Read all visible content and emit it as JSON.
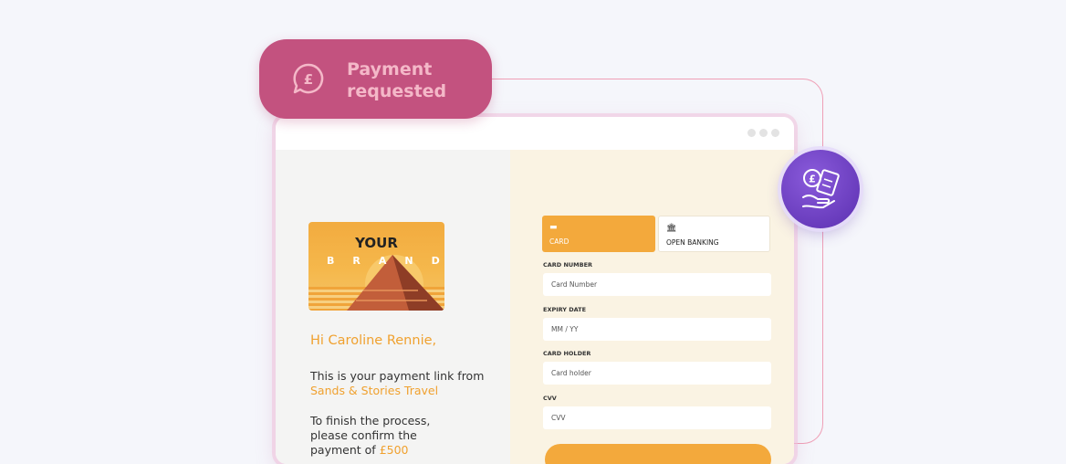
{
  "notification": {
    "title_line1": "Payment",
    "title_line2": "requested",
    "icon": "pound-speech-bubble-icon"
  },
  "badge": {
    "icon": "hand-receipt-payment-icon"
  },
  "brand_card": {
    "line1": "YOUR",
    "line2": "BRAND"
  },
  "message": {
    "greeting": "Hi Caroline Rennie,",
    "line1": "This is your payment link from",
    "merchant": "Sands & Stories Travel",
    "line2a": "To finish the process,",
    "line2b": "please confirm the",
    "line2c": "payment of",
    "amount": "£500"
  },
  "tabs": [
    {
      "label": "CARD",
      "icon": "card-icon",
      "selected": true
    },
    {
      "label": "OPEN BANKING",
      "icon": "bank-icon",
      "selected": false
    }
  ],
  "form": {
    "card_number_label": "CARD NUMBER",
    "card_number_placeholder": "Card Number",
    "expiry_label": "EXPIRY DATE",
    "expiry_placeholder": "MM / YY",
    "holder_label": "CARD HOLDER",
    "holder_placeholder": "Card holder",
    "cvv_label": "CVV",
    "cvv_placeholder": "CVV"
  },
  "colors": {
    "accent": "#f3a93c",
    "pill": "#c3527f",
    "badge": "#6a3cc4"
  }
}
